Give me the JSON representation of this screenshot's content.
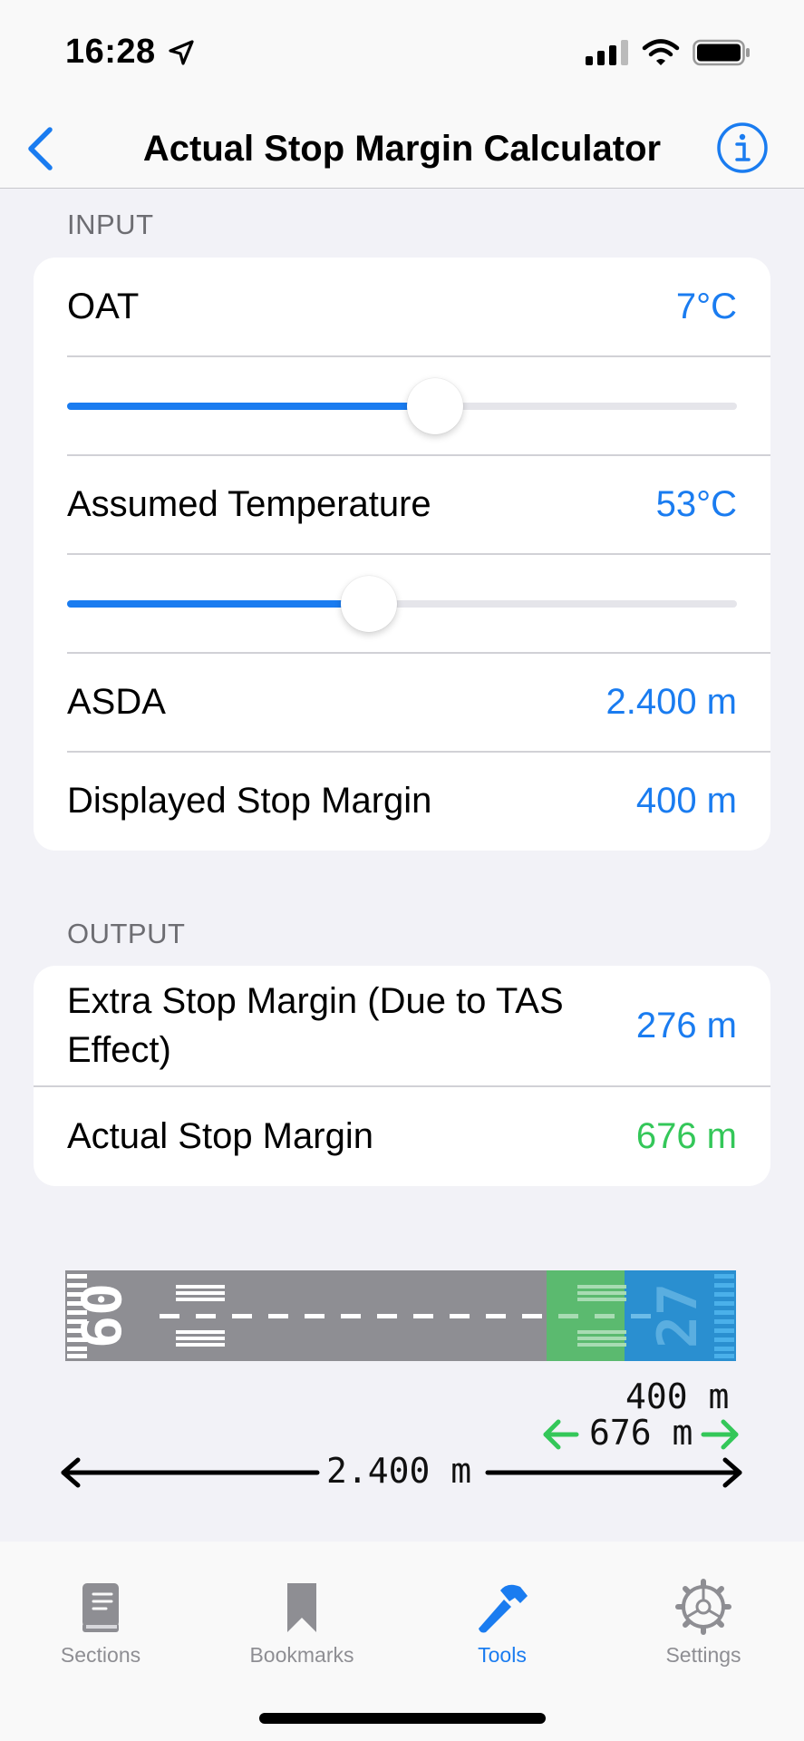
{
  "status_bar": {
    "time": "16:28"
  },
  "nav": {
    "title": "Actual Stop Margin Calculator"
  },
  "input_section": {
    "header": "INPUT",
    "oat": {
      "label": "OAT",
      "value": "7°C",
      "slider_fraction": 0.55
    },
    "assumed_temperature": {
      "label": "Assumed Temperature",
      "value": "53°C",
      "slider_fraction": 0.45
    },
    "asda": {
      "label": "ASDA",
      "value": "2.400 m"
    },
    "displayed_stop_margin": {
      "label": "Displayed Stop Margin",
      "value": "400 m"
    }
  },
  "output_section": {
    "header": "OUTPUT",
    "extra_stop_margin": {
      "label": "Extra Stop Margin (Due to TAS Effect)",
      "value": "276 m"
    },
    "actual_stop_margin": {
      "label": "Actual Stop Margin",
      "value": "676 m"
    }
  },
  "runway_diagram": {
    "threshold_left": "09",
    "threshold_right": "27",
    "displayed_margin": "400 m",
    "actual_margin": "676 m",
    "asda": "2.400 m"
  },
  "tabs": [
    {
      "label": "Sections",
      "icon": "book-icon",
      "active": false
    },
    {
      "label": "Bookmarks",
      "icon": "bookmark-icon",
      "active": false
    },
    {
      "label": "Tools",
      "icon": "hammer-icon",
      "active": true
    },
    {
      "label": "Settings",
      "icon": "gear-icon",
      "active": false
    }
  ],
  "colors": {
    "accent": "#1a7cf0",
    "green": "#34c759",
    "runway": "#8e8e93",
    "margin_green": "#5bba6f",
    "margin_blue": "#2a8fd0"
  }
}
